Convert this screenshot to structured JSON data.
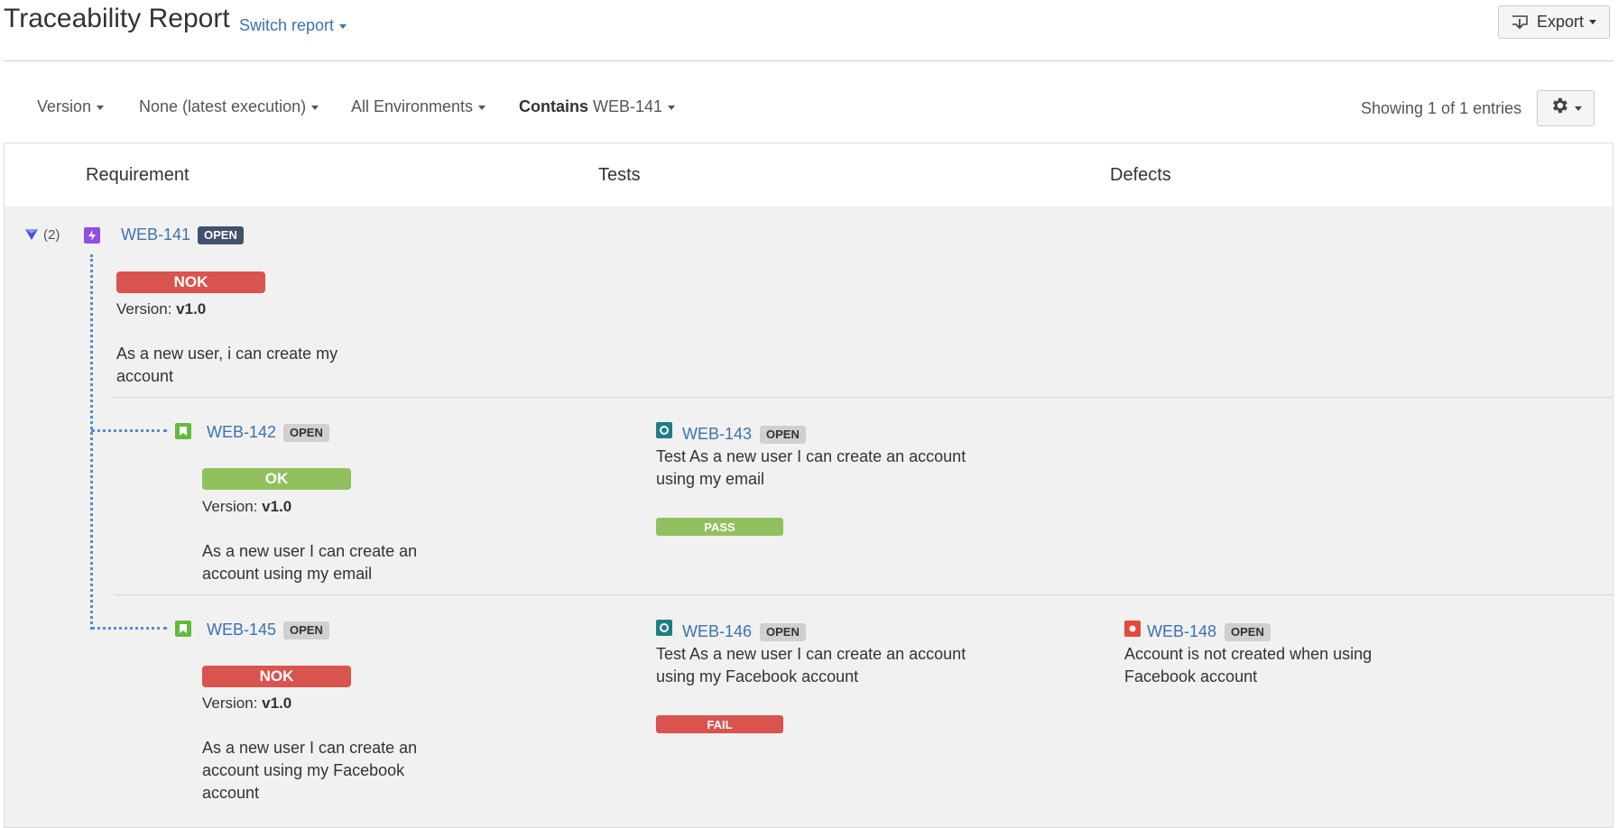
{
  "header": {
    "title": "Traceability Report",
    "switch_report": "Switch report",
    "export_label": "Export"
  },
  "filters": {
    "version": "Version",
    "execution": "None (latest execution)",
    "environments": "All Environments",
    "contains_prefix": "Contains",
    "contains_value": "WEB-141",
    "showing": "Showing 1 of 1 entries"
  },
  "columns": {
    "requirement": "Requirement",
    "tests": "Tests",
    "defects": "Defects"
  },
  "colors": {
    "link": "#3b73af",
    "nok": "#d9534f",
    "ok": "#91c15f",
    "open_dark": "#42526e",
    "open_light": "#d0d0d0",
    "dotted_line": "#4a90d9"
  },
  "requirement": {
    "count": "(2)",
    "icon": "epic-icon",
    "key": "WEB-141",
    "status": "OPEN",
    "result": "NOK",
    "version_label": "Version:",
    "version_value": "v1.0",
    "summary": "As a new user, i can create my account"
  },
  "rows": [
    {
      "story": {
        "icon": "story-icon",
        "key": "WEB-142",
        "status": "OPEN",
        "result": "OK",
        "version_label": "Version:",
        "version_value": "v1.0",
        "summary": "As a new user I can create an account using my email"
      },
      "test": {
        "icon": "test-icon",
        "key": "WEB-143",
        "status": "OPEN",
        "summary": "Test As a new user I can create an account using my email",
        "execution": "PASS"
      }
    },
    {
      "story": {
        "icon": "story-icon",
        "key": "WEB-145",
        "status": "OPEN",
        "result": "NOK",
        "version_label": "Version:",
        "version_value": "v1.0",
        "summary": "As a new user I can create an account using my Facebook account"
      },
      "test": {
        "icon": "test-icon",
        "key": "WEB-146",
        "status": "OPEN",
        "summary": "Test As a new user I can create an account using my Facebook account",
        "execution": "FAIL"
      },
      "defect": {
        "icon": "bug-icon",
        "key": "WEB-148",
        "status": "OPEN",
        "summary": "Account is not created when using Facebook account"
      }
    }
  ]
}
